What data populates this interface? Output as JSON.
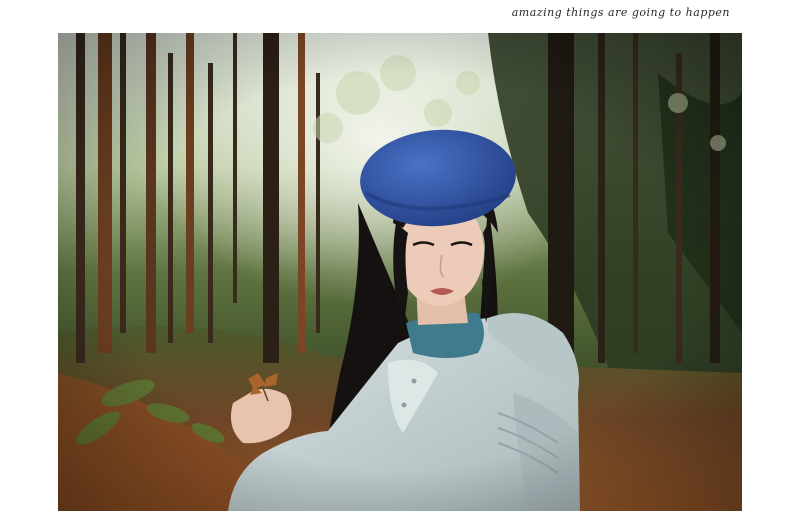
{
  "caption": {
    "text": "amazing  things are going to happen"
  },
  "photo": {
    "subject": "portrait-in-forest",
    "colors": {
      "sky": "#e9f0e6",
      "foliage_dark": "#24311d",
      "foliage_mid": "#4d6235",
      "ground": "#7a4a26",
      "beret": "#2f55a8",
      "hair": "#161312",
      "skin": "#e8c6b2",
      "coat": "#c9d6d6",
      "scarf": "#3f7b8c"
    }
  }
}
